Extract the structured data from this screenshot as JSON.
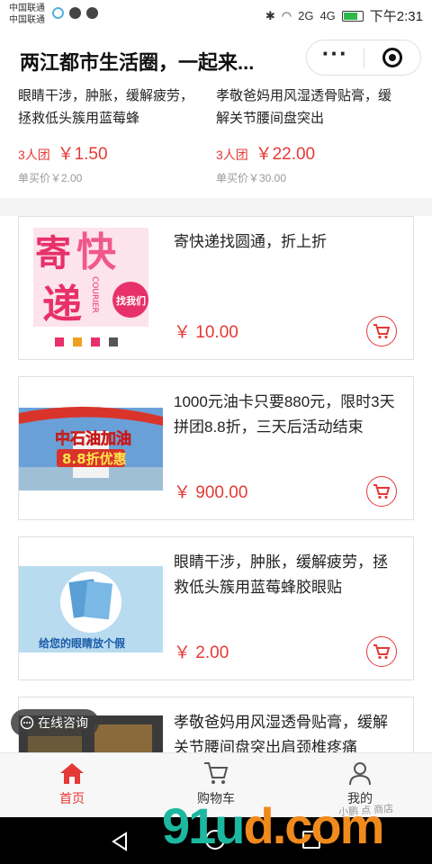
{
  "status": {
    "carrier1": "中国联通",
    "carrier2": "中国联通",
    "network": "4G",
    "signal2": "2G",
    "time": "下午2:31"
  },
  "header": {
    "title": "两江都市生活圈，一起来..."
  },
  "top_grid": [
    {
      "title": "眼睛干涉，肿胀，缓解疲劳，拯救低头簇用蓝莓蜂",
      "group": "3人团",
      "price": "￥1.50",
      "single": "单买价￥2.00"
    },
    {
      "title": "孝敬爸妈用风湿透骨贴膏，缓解关节腰间盘突出",
      "group": "3人团",
      "price": "￥22.00",
      "single": "单买价￥30.00"
    }
  ],
  "products": [
    {
      "title": "寄快递找圆通，折上折",
      "price": "￥ 10.00",
      "thumb": "courier"
    },
    {
      "title": "1000元油卡只要880元，限时3天拼团8.8折，三天后活动结束",
      "price": "￥ 900.00",
      "thumb": "gas"
    },
    {
      "title": "眼睛干涉，肿胀，缓解疲劳，拯救低头簇用蓝莓蜂胶眼贴",
      "price": "￥ 2.00",
      "thumb": "eye"
    },
    {
      "title": "孝敬爸妈用风湿透骨贴膏，缓解关节腰间盘突出肩颈椎疼痛",
      "price": "",
      "thumb": "shop"
    }
  ],
  "thumb_text": {
    "courier_big1": "寄",
    "courier_big2": "快",
    "courier_big3": "递",
    "courier_word": "COURIER",
    "courier_seal": "找我们",
    "gas_sign": "中石油加油",
    "gas_sub": "8.8折优惠",
    "eye_caption": "给您的眼睛放个假"
  },
  "consult": {
    "label": "在线咨询"
  },
  "tabs": [
    {
      "label": "首页",
      "icon": "home-icon",
      "active": true
    },
    {
      "label": "购物车",
      "icon": "cart-icon",
      "active": false
    },
    {
      "label": "我的",
      "icon": "user-icon",
      "active": false
    }
  ],
  "watermark": {
    "main_a": "91u",
    "main_b": "d.com",
    "sub": "小鹏 点  商店"
  },
  "colors": {
    "accent": "#e53935",
    "tab_active": "#e53935"
  }
}
